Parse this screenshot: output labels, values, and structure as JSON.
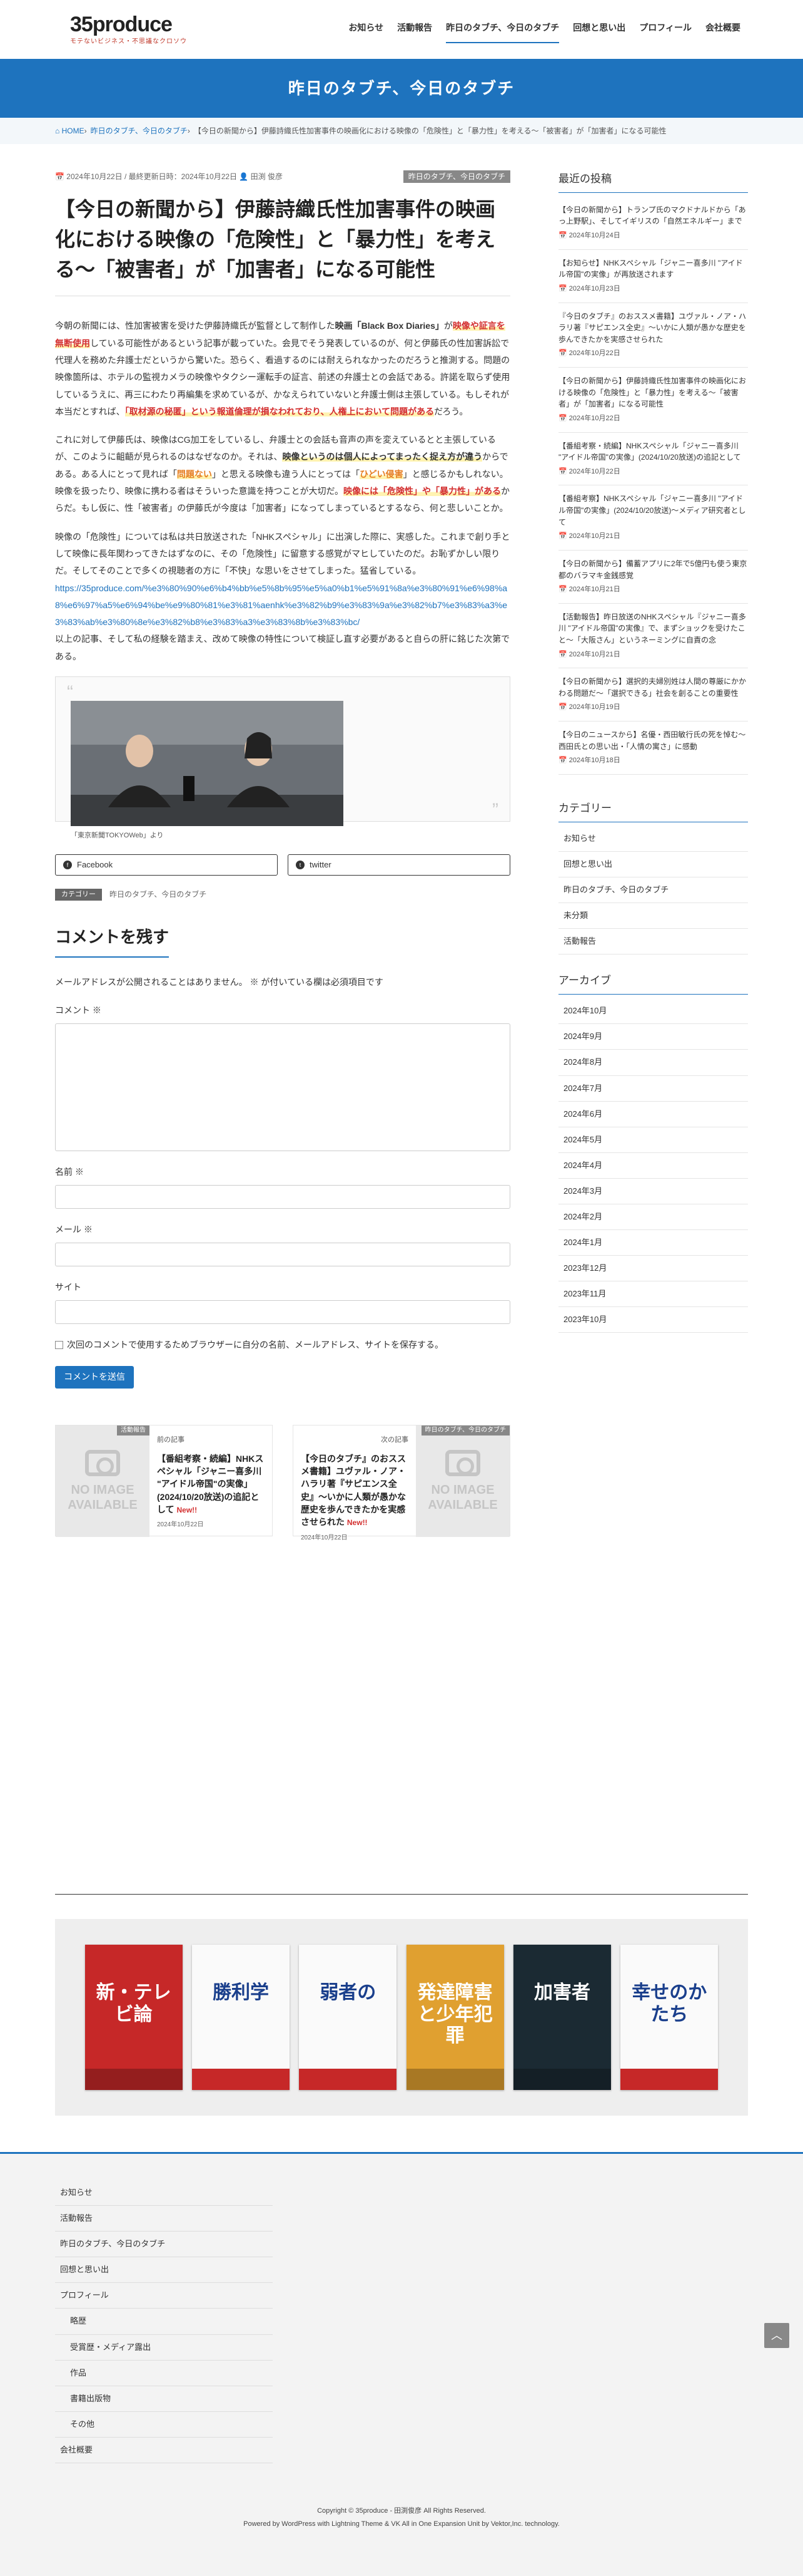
{
  "site": {
    "logo": "35produce",
    "logo_sub": "モテないビジネス・不思議なクロソウ"
  },
  "nav": [
    "お知らせ",
    "活動報告",
    "昨日のタブチ、今日のタブチ",
    "回想と思い出",
    "プロフィール",
    "会社概要"
  ],
  "banner": "昨日のタブチ、今日のタブチ",
  "breadcrumb": [
    "⌂ HOME",
    "›",
    "昨日のタブチ、今日のタブチ",
    "›",
    "【今日の新聞から】伊藤詩織氏性加害事件の映画化における映像の「危険性」と「暴力性」を考える〜「被害者」が「加害者」になる可能性"
  ],
  "post": {
    "dates": "📅 2024年10月22日 / 最終更新日時：2024年10月22日  👤 田渕 俊彦",
    "category": "昨日のタブチ、今日のタブチ",
    "title": "【今日の新聞から】伊藤詩織氏性加害事件の映画化における映像の「危険性」と「暴力性」を考える〜「被害者」が「加害者」になる可能性",
    "p1a": "今朝の新聞には、性加害被害を受けた伊藤詩織氏が監督として制作した",
    "p1b": "映画「Black Box Diaries」",
    "p1c": "が",
    "p1d": "映像や証言を無断使用",
    "p1e": "している可能性があるという記事が載っていた。会見でそう発表しているのが、何と伊藤氏の性加害訴訟で代理人を務めた弁護士だというから驚いた。恐らく、看過するのには耐えられなかったのだろうと推測する。問題の映像箇所は、ホテルの監視カメラの映像やタクシー運転手の証言、前述の弁護士との会話である。許諾を取らず使用しているうえに、再三にわたり再編集を求めているが、かなえられていないと弁護士側は主張している。もしそれが本当だとすれば、",
    "p1f": "「取材源の秘匿」という報道倫理が損なわれており、人権上において問題がある",
    "p1g": "だろう。",
    "p2a": "これに対して伊藤氏は、映像はCG加工をしているし、弁護士との会話も音声の声を変えているとと主張しているが、このように齟齬が見られるのはなぜなのか。それは、",
    "p2b": "映像というのは個人によってまったく捉え方が違う",
    "p2c": "からである。ある人にとって見れば「",
    "p2d": "問題ない",
    "p2e": "」と思える映像も違う人にとっては「",
    "p2f": "ひどい侵害",
    "p2g": "」と感じるかもしれない。映像を扱ったり、映像に携わる者はそういった意識を持つことが大切だ。",
    "p2h": "映像には「危険性」や「暴力性」がある",
    "p2i": "からだ。もし仮に、性「被害者」の伊藤氏が今度は「加害者」になってしまっているとするなら、何と悲しいことか。",
    "p3a": "映像の「危険性」については私は共日放送された「NHKスペシャル」に出演した際に、実感した。これまで創り手として映像に長年関わってきたはずなのに、その「危険性」に留意する感覚がマヒしていたのだ。お恥ずかしい限りだ。そしてそのことで多くの視聴者の方に「不快」な思いをさせてしまった。猛省している。",
    "link": "https://35produce.com/%e3%80%90%e6%b4%bb%e5%8b%95%e5%a0%b1%e5%91%8a%e3%80%91%e6%98%a8%e6%97%a5%e6%94%be%e9%80%81%e3%81%aenhk%e3%82%b9%e3%83%9a%e3%82%b7%e3%83%a3%e3%83%ab%e3%80%8e%e3%82%b8%e3%83%a3%e3%83%8b%e3%83%bc/",
    "p4": "以上の記事、そして私の経験を踏まえ、改めて映像の特性について検証し直す必要があると自らの肝に銘じた次第である。",
    "caption": "「東京新聞TOKYOWeb」より",
    "share_fb": "Facebook",
    "share_tw": "twitter",
    "cat_label": "カテゴリー",
    "cat_value": "昨日のタブチ、今日のタブチ"
  },
  "comment": {
    "title": "コメントを残す",
    "note": "メールアドレスが公開されることはありません。 ※ が付いている欄は必須項目です",
    "comment_label": "コメント ※",
    "name_label": "名前 ※",
    "mail_label": "メール ※",
    "site_label": "サイト",
    "save_text": "次回のコメントで使用するためブラウザーに自分の名前、メールアドレス、サイトを保存する。",
    "submit": "コメントを送信"
  },
  "prevnext": {
    "prev": {
      "dir": "前の記事",
      "tag": "活動報告",
      "title": "【番組考察・続編】NHKスペシャル「ジャニー喜多川 \"アイドル帝国\"の実像」(2024/10/20放送)の追記として",
      "new": "New!!",
      "date": "2024年10月22日"
    },
    "next": {
      "dir": "次の記事",
      "tag": "昨日のタブチ、今日のタブチ",
      "title": "【今日のタブチ』のおススメ書籍】ユヴァル・ノア・ハラリ著『サピエンス全史』〜いかに人類が愚かな歴史を歩んできたかを実感させられた",
      "new": "New!!",
      "date": "2024年10月22日"
    },
    "noimage": "NO IMAGE AVAILABLE"
  },
  "sidebar": {
    "recent_title": "最近の投稿",
    "recent": [
      {
        "title": "【今日の新聞から】トランプ氏のマクドナルドから「あっ上野駅」、そしてイギリスの「自然エネルギー」まで",
        "date": "📅 2024年10月24日"
      },
      {
        "title": "【お知らせ】NHKスペシャル「ジャニー喜多川 \"アイドル帝国\"の実像」が再放送されます",
        "date": "📅 2024年10月23日"
      },
      {
        "title": "『今日のタブチ』のおススメ書籍】ユヴァル・ノア・ハラリ著『サピエンス全史』〜いかに人類が愚かな歴史を歩んできたかを実感させられた",
        "date": "📅 2024年10月22日"
      },
      {
        "title": "【今日の新聞から】伊藤詩織氏性加害事件の映画化における映像の「危険性」と「暴力性」を考える〜「被害者」が「加害者」になる可能性",
        "date": "📅 2024年10月22日"
      },
      {
        "title": "【番組考察・続編】NHKスペシャル「ジャニー喜多川 \"アイドル帝国\"の実像」(2024/10/20放送)の追記として",
        "date": "📅 2024年10月22日"
      },
      {
        "title": "【番組考察】NHKスペシャル「ジャニー喜多川 \"アイドル帝国\"の実像」(2024/10/20放送)〜メディア研究者として",
        "date": "📅 2024年10月21日"
      },
      {
        "title": "【今日の新聞から】備蓄アプリに2年で5億円も使う東京都のバラマキ金銭感覚",
        "date": "📅 2024年10月21日"
      },
      {
        "title": "【活動報告】昨日放送のNHKスペシャル『ジャニー喜多川 \"アイドル帝国\"の実像』で、まずショックを受けたこと〜「大阪さん」というネーミングに自責の念",
        "date": "📅 2024年10月21日"
      },
      {
        "title": "【今日の新聞から】選択的夫婦別姓は人間の尊厳にかかわる問題だ〜「選択できる」社会を創ることの重要性",
        "date": "📅 2024年10月19日"
      },
      {
        "title": "【今日のニュースから】名優・西田敏行氏の死を悼む〜西田氏との思い出・「人情の寓さ」に感動",
        "date": "📅 2024年10月18日"
      }
    ],
    "cat_title": "カテゴリー",
    "categories": [
      "お知らせ",
      "回想と思い出",
      "昨日のタブチ、今日のタブチ",
      "未分類",
      "活動報告"
    ],
    "archive_title": "アーカイブ",
    "archives": [
      "2024年10月",
      "2024年9月",
      "2024年8月",
      "2024年7月",
      "2024年6月",
      "2024年5月",
      "2024年4月",
      "2024年3月",
      "2024年2月",
      "2024年1月",
      "2023年12月",
      "2023年11月",
      "2023年10月"
    ]
  },
  "books": [
    {
      "t": "新・テレビ論",
      "c": "#c62828"
    },
    {
      "t": "勝利学",
      "c": "#fafafa"
    },
    {
      "t": "弱者の",
      "c": "#fafafa"
    },
    {
      "t": "発達障害と少年犯罪",
      "c": "#e0a030"
    },
    {
      "t": "加害者",
      "c": "#1b2a33"
    },
    {
      "t": "幸せのかたち",
      "c": "#fafafa"
    }
  ],
  "footer": {
    "nav": [
      {
        "t": "お知らせ",
        "sub": false
      },
      {
        "t": "活動報告",
        "sub": false
      },
      {
        "t": "昨日のタブチ、今日のタブチ",
        "sub": false
      },
      {
        "t": "回想と思い出",
        "sub": false
      },
      {
        "t": "プロフィール",
        "sub": false
      },
      {
        "t": "略歴",
        "sub": true
      },
      {
        "t": "受賞歴・メディア露出",
        "sub": true
      },
      {
        "t": "作品",
        "sub": true
      },
      {
        "t": "書籍出版物",
        "sub": true
      },
      {
        "t": "その他",
        "sub": true
      },
      {
        "t": "会社概要",
        "sub": false
      }
    ],
    "copy1": "Copyright © 35produce - 田渕俊彦    All Rights Reserved.",
    "copy2": "Powered by WordPress with Lightning Theme & VK All in One Expansion Unit by Vektor,Inc. technology."
  }
}
